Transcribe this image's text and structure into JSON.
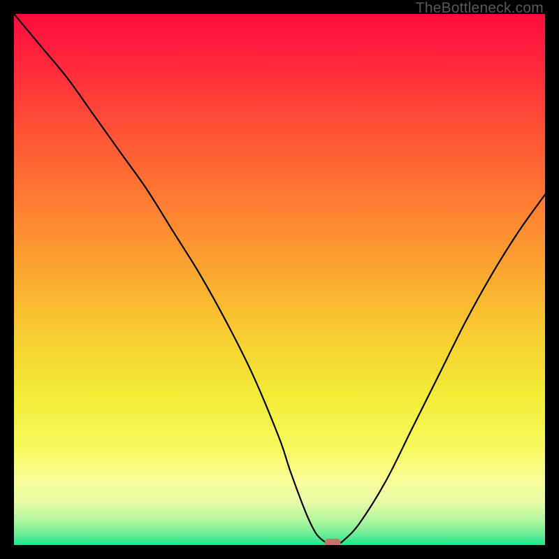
{
  "watermark": "TheBottleneck.com",
  "chart_data": {
    "type": "line",
    "title": "",
    "xlabel": "",
    "ylabel": "",
    "xlim": [
      0,
      100
    ],
    "ylim": [
      0,
      100
    ],
    "series": [
      {
        "name": "curve",
        "x": [
          0,
          5,
          10,
          15,
          20,
          25,
          30,
          35,
          40,
          45,
          50,
          52,
          55,
          57,
          59,
          60,
          61,
          62,
          65,
          70,
          75,
          80,
          85,
          90,
          95,
          100
        ],
        "values": [
          100,
          94,
          88,
          81,
          74,
          67,
          59,
          51,
          42,
          32,
          20,
          14,
          6,
          2,
          0.3,
          0,
          0.3,
          0.8,
          4,
          12,
          22,
          32,
          42,
          51,
          59,
          66
        ]
      }
    ],
    "marker": {
      "x": 60,
      "y": 0,
      "width": 3,
      "height": 1
    },
    "gradient_stops": [
      {
        "offset": 0.0,
        "color": "#ff0b3e"
      },
      {
        "offset": 0.1,
        "color": "#ff2a3c"
      },
      {
        "offset": 0.22,
        "color": "#ff5236"
      },
      {
        "offset": 0.35,
        "color": "#fe7b33"
      },
      {
        "offset": 0.48,
        "color": "#fba531"
      },
      {
        "offset": 0.6,
        "color": "#f7cc32"
      },
      {
        "offset": 0.72,
        "color": "#f2ed37"
      },
      {
        "offset": 0.82,
        "color": "#f7fa61"
      },
      {
        "offset": 0.88,
        "color": "#fbfe99"
      },
      {
        "offset": 0.92,
        "color": "#e6fba8"
      },
      {
        "offset": 0.95,
        "color": "#b8f6a0"
      },
      {
        "offset": 0.975,
        "color": "#7bef98"
      },
      {
        "offset": 1.0,
        "color": "#1de58e"
      }
    ],
    "marker_color": "#cd7066"
  }
}
